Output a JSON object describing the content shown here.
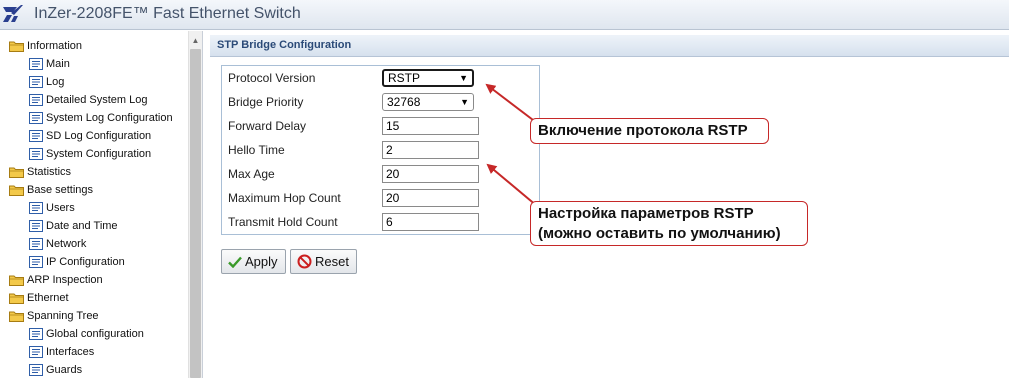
{
  "app": {
    "title": "InZer-2208FE™ Fast Ethernet Switch"
  },
  "sidebar": {
    "items": [
      {
        "label": "Information",
        "type": "folder"
      },
      {
        "label": "Main",
        "type": "leaf"
      },
      {
        "label": "Log",
        "type": "leaf"
      },
      {
        "label": "Detailed System Log",
        "type": "leaf"
      },
      {
        "label": "System Log Configuration",
        "type": "leaf"
      },
      {
        "label": "SD Log Configuration",
        "type": "leaf"
      },
      {
        "label": "System Configuration",
        "type": "leaf"
      },
      {
        "label": "Statistics",
        "type": "folder"
      },
      {
        "label": "Base settings",
        "type": "folder"
      },
      {
        "label": "Users",
        "type": "leaf"
      },
      {
        "label": "Date and Time",
        "type": "leaf"
      },
      {
        "label": "Network",
        "type": "leaf"
      },
      {
        "label": "IP Configuration",
        "type": "leaf"
      },
      {
        "label": "ARP Inspection",
        "type": "folder"
      },
      {
        "label": "Ethernet",
        "type": "folder"
      },
      {
        "label": "Spanning Tree",
        "type": "folder"
      },
      {
        "label": "Global configuration",
        "type": "leaf"
      },
      {
        "label": "Interfaces",
        "type": "leaf"
      },
      {
        "label": "Guards",
        "type": "leaf"
      }
    ]
  },
  "main": {
    "section_title": "STP Bridge Configuration",
    "fields": {
      "protocol_version": {
        "label": "Protocol Version",
        "value": "RSTP"
      },
      "bridge_priority": {
        "label": "Bridge Priority",
        "value": "32768"
      },
      "forward_delay": {
        "label": "Forward Delay",
        "value": "15"
      },
      "hello_time": {
        "label": "Hello Time",
        "value": "2"
      },
      "max_age": {
        "label": "Max Age",
        "value": "20"
      },
      "max_hop_count": {
        "label": "Maximum Hop Count",
        "value": "20"
      },
      "transmit_hold_count": {
        "label": "Transmit Hold Count",
        "value": "6"
      }
    },
    "buttons": {
      "apply": "Apply",
      "reset": "Reset"
    }
  },
  "annotations": {
    "callout_1": "Включение протокола RSTP",
    "callout_2_line1": "Настройка параметров RSTP",
    "callout_2_line2": "(можно оставить по умолчанию)"
  },
  "colors": {
    "annotation": "#c62828",
    "header_bg": "#dfe6ef",
    "section_title": "#2b4a78",
    "folder_icon": "#e0b028"
  },
  "icons": {
    "folder": "folder-icon",
    "page": "page-icon",
    "apply": "checkmark-icon",
    "reset": "prohibited-icon",
    "logo": "brand-logo"
  }
}
